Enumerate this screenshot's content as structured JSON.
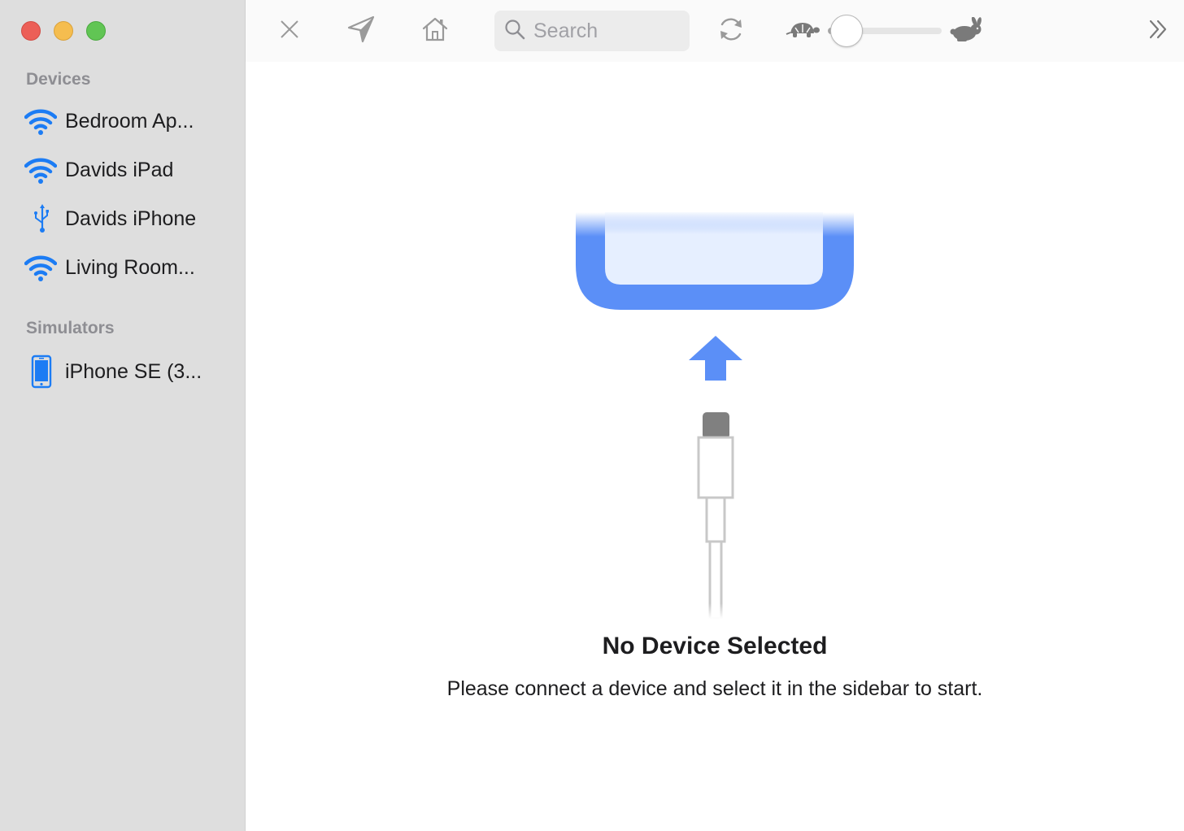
{
  "window": {
    "title": ""
  },
  "sidebar": {
    "sections": [
      {
        "title": "Devices",
        "items": [
          {
            "label": "Bedroom Ap...",
            "icon": "wifi-icon"
          },
          {
            "label": "Davids iPad",
            "icon": "wifi-icon"
          },
          {
            "label": "Davids iPhone",
            "icon": "usb-icon"
          },
          {
            "label": "Living Room...",
            "icon": "wifi-icon"
          }
        ]
      },
      {
        "title": "Simulators",
        "items": [
          {
            "label": "iPhone SE (3...",
            "icon": "iphone-icon"
          }
        ]
      }
    ]
  },
  "toolbar": {
    "close_icon": "close-icon",
    "location_icon": "location-arrow-icon",
    "home_icon": "home-icon",
    "search": {
      "placeholder": "Search",
      "value": ""
    },
    "refresh_icon": "refresh-icon",
    "speed": {
      "slow_icon": "turtle-icon",
      "fast_icon": "rabbit-icon",
      "level": 0.1
    },
    "more_icon": "chevron-double-right-icon"
  },
  "main": {
    "empty_state": {
      "title": "No Device Selected",
      "subtitle": "Please connect a device and select it in the sidebar to start."
    }
  },
  "colors": {
    "accent": "#1c7cf4",
    "illustration_blue": "#5b8ff7",
    "sidebar_bg": "#dedede",
    "section_text": "#8e8e93"
  }
}
